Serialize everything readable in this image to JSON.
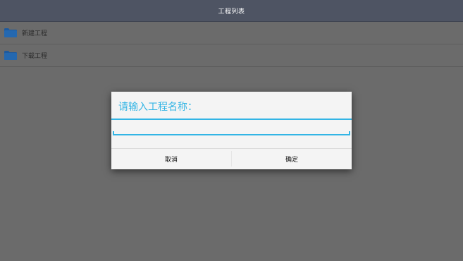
{
  "header": {
    "title": "工程列表"
  },
  "list": {
    "items": [
      {
        "label": "新建工程",
        "icon": "folder-icon"
      },
      {
        "label": "下载工程",
        "icon": "folder-icon"
      }
    ]
  },
  "dialog": {
    "title": "请输入工程名称：",
    "input_value": "",
    "input_placeholder": "",
    "cancel_label": "取消",
    "ok_label": "确定"
  },
  "colors": {
    "accent": "#33b5e5",
    "titlebar": "#4e5463",
    "folder": "#1e5a9e",
    "backdrop": "#6b6b6b"
  }
}
